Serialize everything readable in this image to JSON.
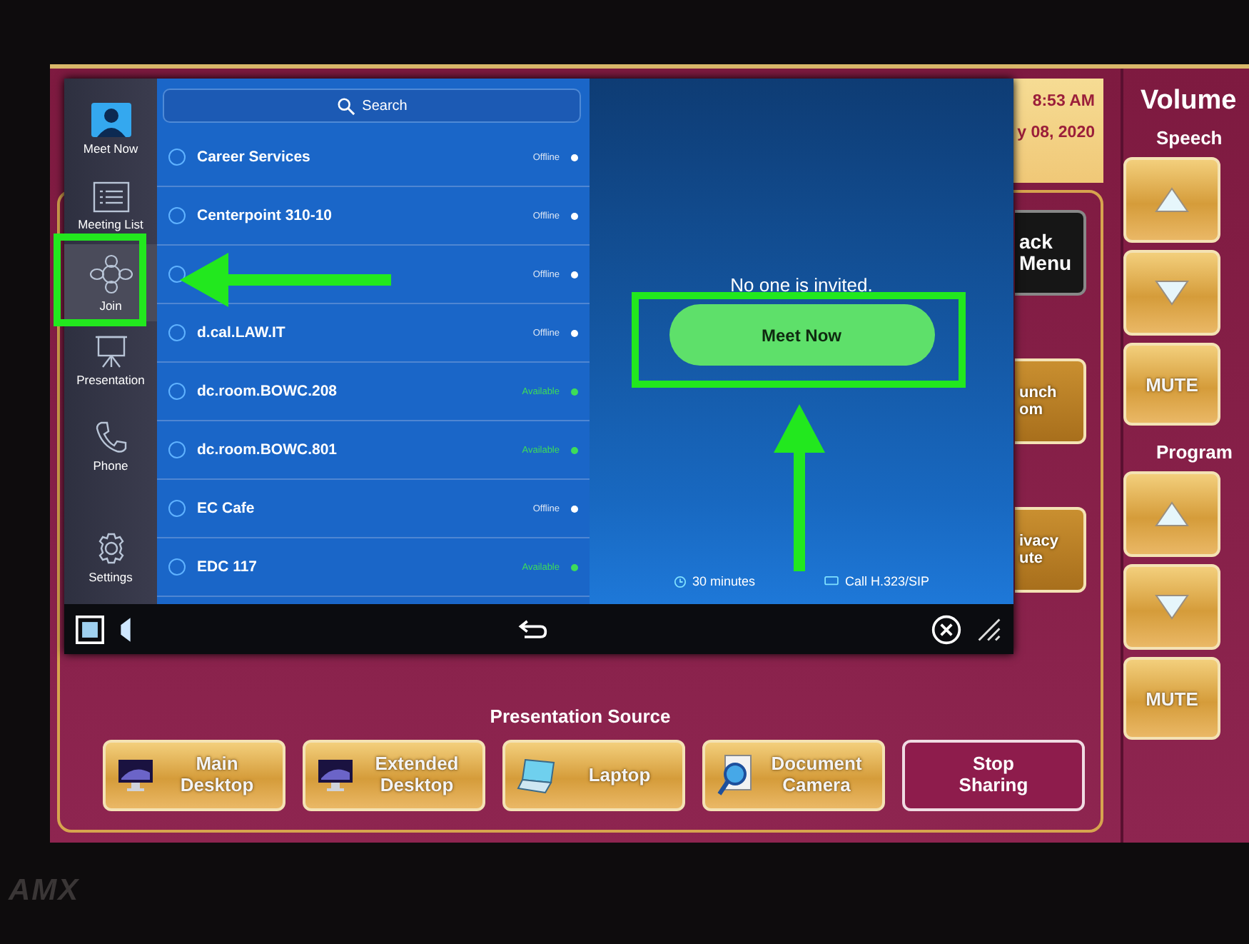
{
  "sidebar": {
    "items": [
      {
        "label": "Meet Now",
        "kind": "person",
        "selected": false
      },
      {
        "label": "Meeting List",
        "kind": "list",
        "selected": false
      },
      {
        "label": "Join",
        "kind": "join",
        "selected": true
      },
      {
        "label": "Presentation",
        "kind": "easel",
        "selected": false
      },
      {
        "label": "Phone",
        "kind": "phone",
        "selected": false
      },
      {
        "label": "Settings",
        "kind": "gear",
        "selected": false
      }
    ]
  },
  "search": {
    "placeholder": "Search"
  },
  "contacts": [
    {
      "name": "Career Services",
      "status": "Offline",
      "color": "#ffffff"
    },
    {
      "name": "Centerpoint 310-10",
      "status": "Offline",
      "color": "#ffffff"
    },
    {
      "status": "Offline",
      "color": "#ffffff"
    },
    {
      "name": "d.cal.LAW.IT",
      "status": "Offline",
      "color": "#ffffff"
    },
    {
      "name": "dc.room.BOWC.208",
      "status": "Available",
      "color": "#3ddc5a"
    },
    {
      "name": "dc.room.BOWC.801",
      "status": "Available",
      "color": "#3ddc5a"
    },
    {
      "name": "EC Cafe",
      "status": "Offline",
      "color": "#ffffff"
    },
    {
      "name": "EDC 117",
      "status": "Available",
      "color": "#3ddc5a"
    }
  ],
  "invite_message": "No one is invited.",
  "meet_button": "Meet Now",
  "duration": "30 minutes",
  "call_type": "Call H.323/SIP",
  "clock": {
    "time": "8:53 AM",
    "date": "y 08, 2020"
  },
  "side_buttons": [
    {
      "label": "ack\nMenu",
      "kind": "dark"
    },
    {
      "label": "unch\nom",
      "kind": "gold"
    },
    {
      "label": "ivacy\nute",
      "kind": "gold"
    }
  ],
  "volume": {
    "title": "Volume",
    "groups": [
      {
        "label": "Speech",
        "mute": "MUTE"
      },
      {
        "label": "Program",
        "mute": "MUTE"
      }
    ]
  },
  "presentation": {
    "title": "Presentation Source",
    "sources": [
      {
        "label": "Main\nDesktop",
        "kind": "desktop"
      },
      {
        "label": "Extended\nDesktop",
        "kind": "desktop"
      },
      {
        "label": "Laptop",
        "kind": "laptop"
      },
      {
        "label": "Document\nCamera",
        "kind": "camera"
      },
      {
        "label": "Stop\nSharing",
        "kind": "stop"
      }
    ]
  },
  "logo": "AMX"
}
